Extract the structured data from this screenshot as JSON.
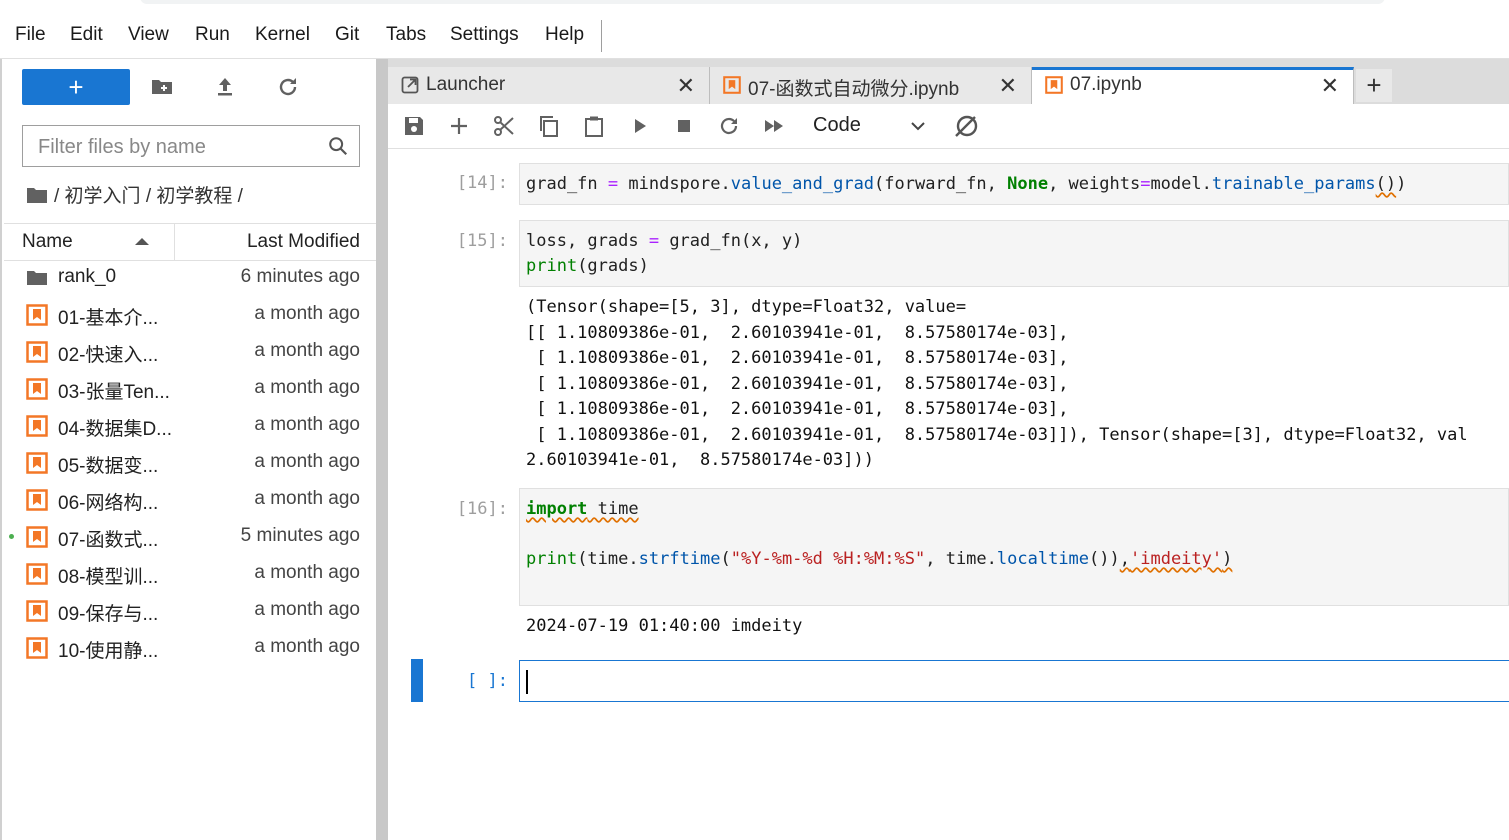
{
  "menu": [
    "File",
    "Edit",
    "View",
    "Run",
    "Kernel",
    "Git",
    "Tabs",
    "Settings",
    "Help"
  ],
  "sidebar": {
    "new_label": "+",
    "filter_placeholder": "Filter files by name",
    "breadcrumb": "/ 初学入门 / 初学教程 /",
    "columns": {
      "name": "Name",
      "modified": "Last Modified"
    },
    "files": [
      {
        "name": "rank_0",
        "modified": "6 minutes ago",
        "type": "folder"
      },
      {
        "name": "01-基本介...",
        "modified": "a month ago",
        "type": "notebook"
      },
      {
        "name": "02-快速入...",
        "modified": "a month ago",
        "type": "notebook"
      },
      {
        "name": "03-张量Ten...",
        "modified": "a month ago",
        "type": "notebook"
      },
      {
        "name": "04-数据集D...",
        "modified": "a month ago",
        "type": "notebook"
      },
      {
        "name": "05-数据变...",
        "modified": "a month ago",
        "type": "notebook"
      },
      {
        "name": "06-网络构...",
        "modified": "a month ago",
        "type": "notebook"
      },
      {
        "name": "07-函数式...",
        "modified": "5 minutes ago",
        "type": "notebook",
        "running": true
      },
      {
        "name": "08-模型训...",
        "modified": "a month ago",
        "type": "notebook"
      },
      {
        "name": "09-保存与...",
        "modified": "a month ago",
        "type": "notebook"
      },
      {
        "name": "10-使用静...",
        "modified": "a month ago",
        "type": "notebook"
      }
    ]
  },
  "tabs": [
    {
      "label": "Launcher",
      "icon": "launcher-icon",
      "close": "✕"
    },
    {
      "label": "07-函数式自动微分.ipynb",
      "icon": "notebook-icon",
      "close": "✕"
    },
    {
      "label": "07.ipynb",
      "icon": "notebook-icon",
      "close": "✕",
      "active": true
    }
  ],
  "add_tab": "+",
  "toolbar": {
    "cell_type": "Code"
  },
  "cells": {
    "c14": {
      "prompt": "[14]:"
    },
    "c15": {
      "prompt": "[15]:",
      "output": "(Tensor(shape=[5, 3], dtype=Float32, value=\n[[ 1.10809386e-01,  2.60103941e-01,  8.57580174e-03],\n [ 1.10809386e-01,  2.60103941e-01,  8.57580174e-03],\n [ 1.10809386e-01,  2.60103941e-01,  8.57580174e-03],\n [ 1.10809386e-01,  2.60103941e-01,  8.57580174e-03],\n [ 1.10809386e-01,  2.60103941e-01,  8.57580174e-03]]), Tensor(shape=[3], dtype=Float32, val\n2.60103941e-01,  8.57580174e-03]))"
    },
    "c16": {
      "prompt": "[16]:",
      "output": "2024-07-19 01:40:00 imdeity"
    },
    "empty": {
      "prompt": "[ ]:"
    }
  },
  "colors": {
    "accent": "#1976d2",
    "notebook_icon": "#f37726",
    "keyword": "#008000",
    "string": "#ba2121"
  }
}
